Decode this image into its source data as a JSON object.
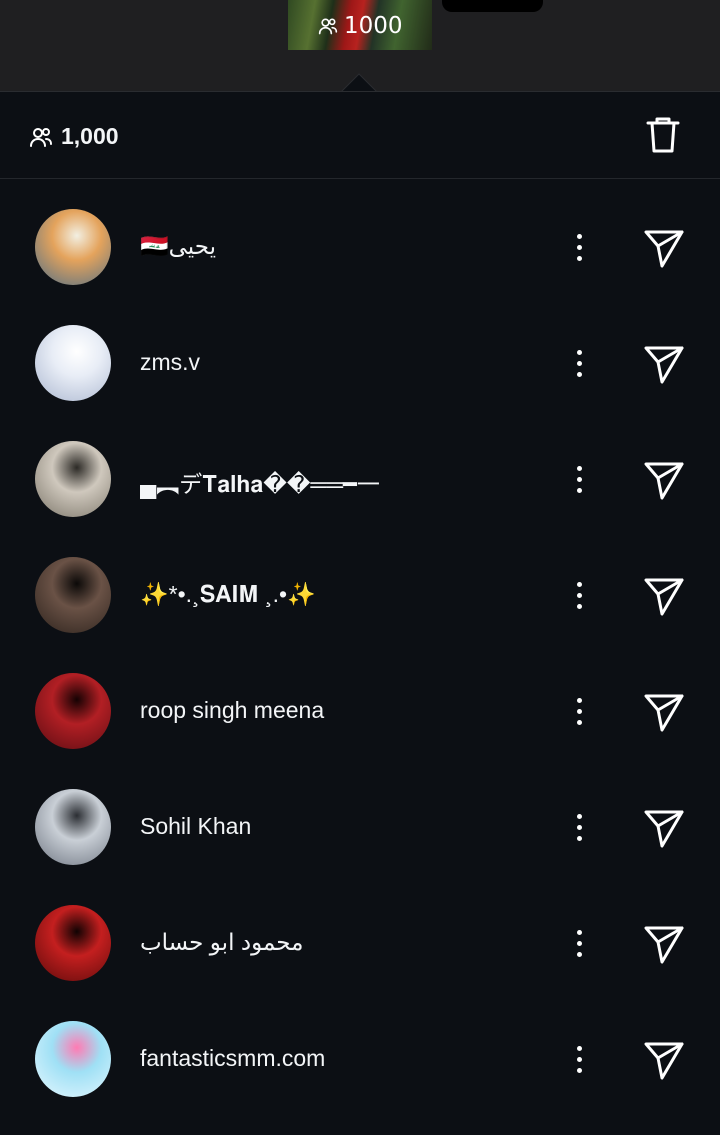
{
  "top": {
    "thumbnail_count": "1000",
    "people_icon": "people-icon"
  },
  "summary": {
    "count": "1,000",
    "delete_icon": "trash-icon"
  },
  "users": [
    {
      "name": "يحيى🇮🇶",
      "avatar_colors": [
        "#e4a35c",
        "#4d6e88",
        "#f2efe2"
      ],
      "direction": "rtl"
    },
    {
      "name": "zms.v",
      "avatar_colors": [
        "#e8edf6",
        "#aab6cf",
        "#ffffff"
      ],
      "direction": "ltr"
    },
    {
      "name": "▄︻デ𝐓𝐚𝐥𝐡𝐚��══━一",
      "avatar_colors": [
        "#cfc8bd",
        "#7a7468",
        "#2c2a26"
      ],
      "direction": "ltr"
    },
    {
      "name": "✨*•.¸𝐒𝐀𝐈𝐌 ¸.•✨",
      "avatar_colors": [
        "#6a5246",
        "#2c221c",
        "#0b0908"
      ],
      "direction": "ltr"
    },
    {
      "name": "roop singh meena",
      "avatar_colors": [
        "#b21f24",
        "#5a0c12",
        "#150203"
      ],
      "direction": "ltr"
    },
    {
      "name": "Sohil Khan",
      "avatar_colors": [
        "#c9cfd6",
        "#6d7480",
        "#2b2e33"
      ],
      "direction": "ltr"
    },
    {
      "name": "محمود ابو حساب",
      "avatar_colors": [
        "#c41f1f",
        "#5a0a0a",
        "#100303"
      ],
      "direction": "rtl"
    },
    {
      "name": "fantasticsmm.com",
      "avatar_colors": [
        "#9fe0f5",
        "#e8f8ff",
        "#ff7bb3"
      ],
      "direction": "ltr"
    }
  ],
  "row_actions": {
    "more_icon": "more-vertical-icon",
    "send_icon": "send-icon"
  }
}
